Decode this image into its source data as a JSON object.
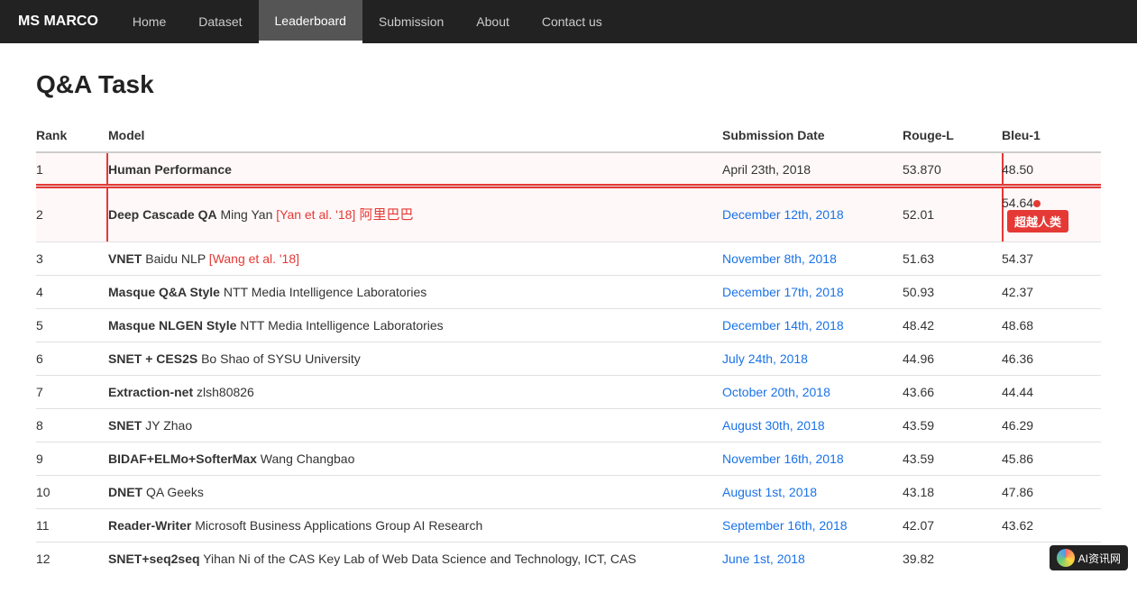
{
  "brand": "MS MARCO",
  "nav": {
    "items": [
      {
        "label": "Home",
        "active": false
      },
      {
        "label": "Dataset",
        "active": false
      },
      {
        "label": "Leaderboard",
        "active": true
      },
      {
        "label": "Submission",
        "active": false
      },
      {
        "label": "About",
        "active": false
      },
      {
        "label": "Contact us",
        "active": false
      }
    ]
  },
  "page": {
    "title": "Q&A Task"
  },
  "table": {
    "headers": [
      "Rank",
      "Model",
      "Submission Date",
      "Rouge-L",
      "Bleu-1"
    ],
    "rows": [
      {
        "rank": "1",
        "model_bold": "Human Performance",
        "model_desc": "",
        "date": "April 23th, 2018",
        "date_link": false,
        "rouge": "53.870",
        "bleu": "48.50",
        "highlight": true,
        "badge": false
      },
      {
        "rank": "2",
        "model_bold": "Deep Cascade QA",
        "model_desc": "Ming Yan",
        "model_link_text": "[Yan et al. '18]",
        "model_chinese": "阿里巴巴",
        "date": "December 12th, 2018",
        "date_link": true,
        "rouge": "52.01",
        "bleu": "54.64",
        "highlight": true,
        "badge": true,
        "badge_text": "超越人类"
      },
      {
        "rank": "3",
        "model_bold": "VNET",
        "model_desc": "Baidu NLP",
        "model_link_text": "[Wang et al. '18]",
        "date": "November 8th, 2018",
        "date_link": true,
        "rouge": "51.63",
        "bleu": "54.37",
        "highlight": false,
        "badge": false
      },
      {
        "rank": "4",
        "model_bold": "Masque Q&A Style",
        "model_desc": "NTT Media Intelligence Laboratories",
        "date": "December 17th, 2018",
        "date_link": true,
        "rouge": "50.93",
        "bleu": "42.37",
        "highlight": false,
        "badge": false
      },
      {
        "rank": "5",
        "model_bold": "Masque NLGEN Style",
        "model_desc": "NTT Media Intelligence Laboratories",
        "date": "December 14th, 2018",
        "date_link": true,
        "rouge": "48.42",
        "bleu": "48.68",
        "highlight": false,
        "badge": false
      },
      {
        "rank": "6",
        "model_bold": "SNET + CES2S",
        "model_desc": "Bo Shao of SYSU University",
        "date": "July 24th, 2018",
        "date_link": true,
        "rouge": "44.96",
        "bleu": "46.36",
        "highlight": false,
        "badge": false
      },
      {
        "rank": "7",
        "model_bold": "Extraction-net",
        "model_desc": "zlsh80826",
        "date": "October 20th, 2018",
        "date_link": true,
        "rouge": "43.66",
        "bleu": "44.44",
        "highlight": false,
        "badge": false
      },
      {
        "rank": "8",
        "model_bold": "SNET",
        "model_desc": "JY Zhao",
        "date": "August 30th, 2018",
        "date_link": true,
        "rouge": "43.59",
        "bleu": "46.29",
        "highlight": false,
        "badge": false
      },
      {
        "rank": "9",
        "model_bold": "BIDAF+ELMo+SofterMax",
        "model_desc": "Wang Changbao",
        "date": "November 16th, 2018",
        "date_link": true,
        "rouge": "43.59",
        "bleu": "45.86",
        "highlight": false,
        "badge": false
      },
      {
        "rank": "10",
        "model_bold": "DNET",
        "model_desc": "QA Geeks",
        "date": "August 1st, 2018",
        "date_link": true,
        "rouge": "43.18",
        "bleu": "47.86",
        "highlight": false,
        "badge": false
      },
      {
        "rank": "11",
        "model_bold": "Reader-Writer",
        "model_desc": "Microsoft Business Applications Group AI Research",
        "date": "September 16th, 2018",
        "date_link": true,
        "rouge": "42.07",
        "bleu": "43.62",
        "highlight": false,
        "badge": false
      },
      {
        "rank": "12",
        "model_bold": "SNET+seq2seq",
        "model_desc": "Yihan Ni of the CAS Key Lab of Web Data Science and Technology, ICT, CAS",
        "date": "June 1st, 2018",
        "date_link": true,
        "rouge": "39.82",
        "bleu": "",
        "highlight": false,
        "badge": false
      }
    ]
  },
  "watermark": {
    "text": "AI资讯网"
  }
}
